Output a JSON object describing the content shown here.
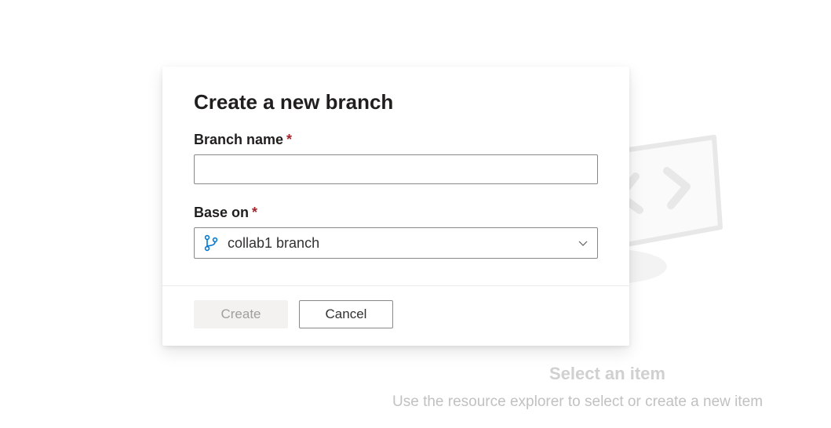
{
  "background": {
    "heading": "Select an item",
    "subheading": "Use the resource explorer to select or create a new item"
  },
  "dialog": {
    "title": "Create a new branch",
    "fields": {
      "branch_name": {
        "label": "Branch name",
        "required_mark": "*",
        "value": ""
      },
      "base_on": {
        "label": "Base on",
        "required_mark": "*",
        "selected": "collab1 branch"
      }
    },
    "buttons": {
      "create": "Create",
      "cancel": "Cancel"
    }
  },
  "icons": {
    "branch": "git-branch-icon",
    "chevron": "chevron-down-icon"
  },
  "colors": {
    "accent": "#0078d4",
    "required": "#a4262c"
  }
}
